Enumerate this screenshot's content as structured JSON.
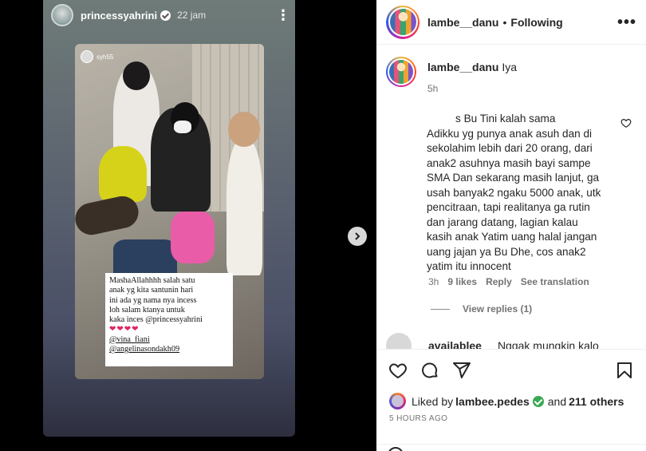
{
  "story": {
    "username": "princessyahrini",
    "time": "22 jam",
    "inner_username": "syh55",
    "caption_lines": [
      "MashaAllahhhh salah satu",
      "anak yg kita santunin hari",
      "ini ada yg nama nya incess",
      "loh salam ktanya untuk",
      "kaka inces @princessyahrini"
    ],
    "hearts": "❤❤❤❤",
    "tags": [
      "@vina_fiani",
      "@angelinasondakh09"
    ]
  },
  "header": {
    "username": "lambe__danu",
    "separator": "•",
    "follow_status": "Following",
    "more": "•••"
  },
  "post_caption": {
    "username": "lambe__danu",
    "text": "Iya",
    "time": "5h"
  },
  "comment": {
    "lines": [
      "s Bu Tini kalah sama",
      "Adikku yg punya anak asuh dan di",
      "sekolahim lebih dari 20 orang, dari",
      "anak2 asuhnya masih bayi sampe",
      "SMA Dan sekarang masih lanjut, ga",
      "usah banyak2 ngaku 5000 anak, utk",
      "pencitraan, tapi realitanya ga rutin",
      "dan jarang datang, lagian kalau",
      "kasih anak Yatim uang halal jangan",
      "uang jajan ya Bu Dhe, cos anak2",
      "yatim itu innocent"
    ],
    "time": "3h",
    "likes": "9 likes",
    "reply": "Reply",
    "translate": "See translation",
    "view_replies": "View replies (1)"
  },
  "next_comment": {
    "username": "availablee",
    "text": "Nggak mungkin kalo"
  },
  "likes": {
    "prefix": "Liked by",
    "user": "lambee.pedes",
    "conj": "and",
    "count": "211 others"
  },
  "post_time": "5 HOURS AGO",
  "colors": {
    "verified_green": "#3aa855",
    "text_primary": "#262626",
    "text_secondary": "#737373"
  }
}
